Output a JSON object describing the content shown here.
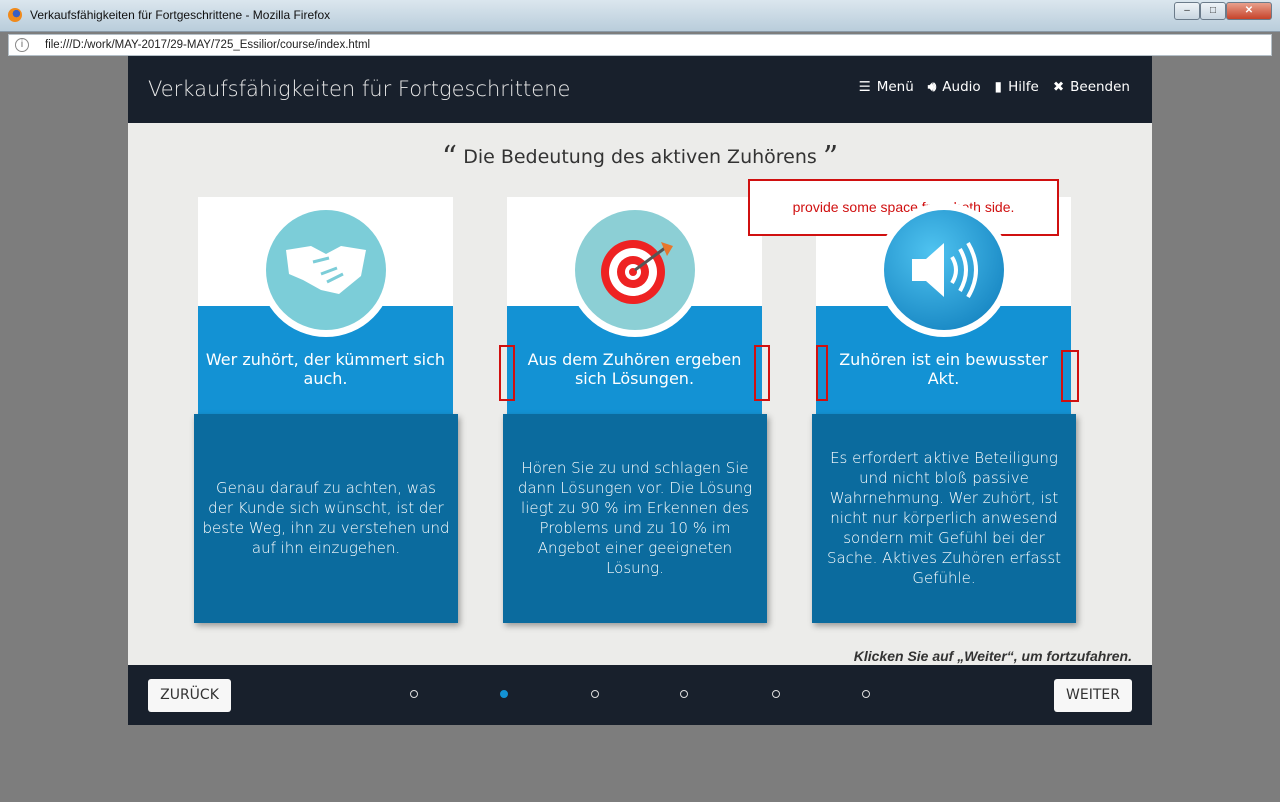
{
  "browser": {
    "window_title": "Verkaufsfähigkeiten für Fortgeschrittene - Mozilla Firefox",
    "url": "file:///D:/work/MAY-2017/29-MAY/725_Essilior/course/index.html"
  },
  "course": {
    "title": "Verkaufsfähigkeiten für Fortgeschrittene",
    "nav": [
      {
        "label": "Menü",
        "icon": "list-icon"
      },
      {
        "label": "Audio",
        "icon": "speaker-icon"
      },
      {
        "label": "Hilfe",
        "icon": "book-icon"
      },
      {
        "label": "Beenden",
        "icon": "close-icon"
      }
    ],
    "heading": "Die Bedeutung des aktiven Zuhörens",
    "cards": [
      {
        "icon": "handshake-icon",
        "title": "Wer zuhört, der kümmert sich auch.",
        "text": "Genau darauf zu achten, was der Kunde sich wünscht, ist der beste Weg, ihn zu verstehen und auf ihn einzugehen."
      },
      {
        "icon": "target-icon",
        "title": "Aus dem Zuhören ergeben sich Lösungen.",
        "text": "Hören Sie zu und schlagen Sie dann Lösungen vor. Die Lösung liegt zu 90 % im Erkennen des Problems und zu 10 % im Angebot einer geeigneten Lösung."
      },
      {
        "icon": "speaker-icon",
        "title": "Zuhören ist ein bewusster Akt.",
        "text": "Es erfordert aktive Beteiligung und nicht bloß passive Wahrnehmung. Wer zuhört, ist nicht nur körperlich anwesend sondern mit Gefühl bei der Sache. Aktives Zuhören erfasst Gefühle."
      }
    ],
    "hint": "Klicken Sie auf „Weiter“, um fortzufahren.",
    "back_label": "ZURÜCK",
    "next_label": "WEITER",
    "pages": {
      "total": 6,
      "current": 2
    }
  },
  "annotation": {
    "text": "provide some space from both side."
  },
  "colors": {
    "header": "#18202c",
    "accent": "#1392d4",
    "card_dark": "#0b6b9e",
    "annotation": "#d01010"
  }
}
